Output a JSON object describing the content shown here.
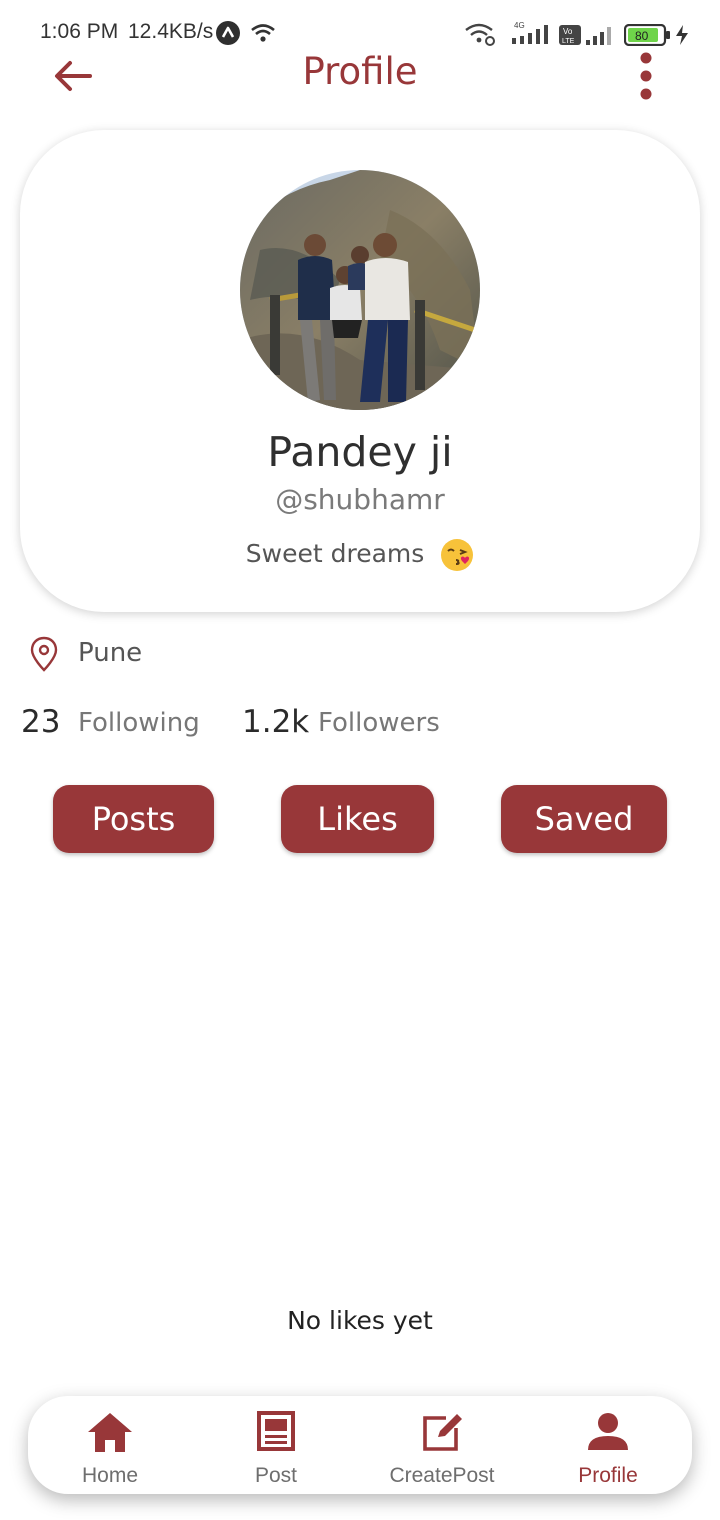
{
  "status_bar": {
    "time": "1:06 PM",
    "network_speed": "12.4KB/s",
    "battery_level": "80",
    "icons": [
      "app-notification-icon",
      "wifi-icon",
      "hotspot-icon",
      "signal-4g-icon",
      "volte-icon",
      "signal-icon",
      "battery-icon",
      "charging-icon"
    ]
  },
  "header": {
    "title": "Profile",
    "back_icon": "arrow-left-icon",
    "menu_icon": "more-vertical-icon"
  },
  "profile": {
    "name": "Pandey ji",
    "handle": "@shubhamr",
    "bio": "Sweet dreams",
    "bio_emoji": "face-blowing-kiss-emoji",
    "location": "Pune",
    "following_count": "23",
    "following_label": "Following",
    "followers_count": "1.2k",
    "followers_label": "Followers"
  },
  "tabs": [
    {
      "label": "Posts"
    },
    {
      "label": "Likes"
    },
    {
      "label": "Saved"
    }
  ],
  "content": {
    "empty_message": "No likes yet"
  },
  "bottom_nav": {
    "items": [
      {
        "label": "Home",
        "icon": "home-icon"
      },
      {
        "label": "Post",
        "icon": "post-icon"
      },
      {
        "label": "CreatePost",
        "icon": "edit-icon"
      },
      {
        "label": "Profile",
        "icon": "person-icon"
      }
    ],
    "active": "Profile"
  },
  "colors": {
    "accent": "#983739",
    "text": "#2b2b2b",
    "muted": "#777777",
    "background": "#ffffff"
  }
}
